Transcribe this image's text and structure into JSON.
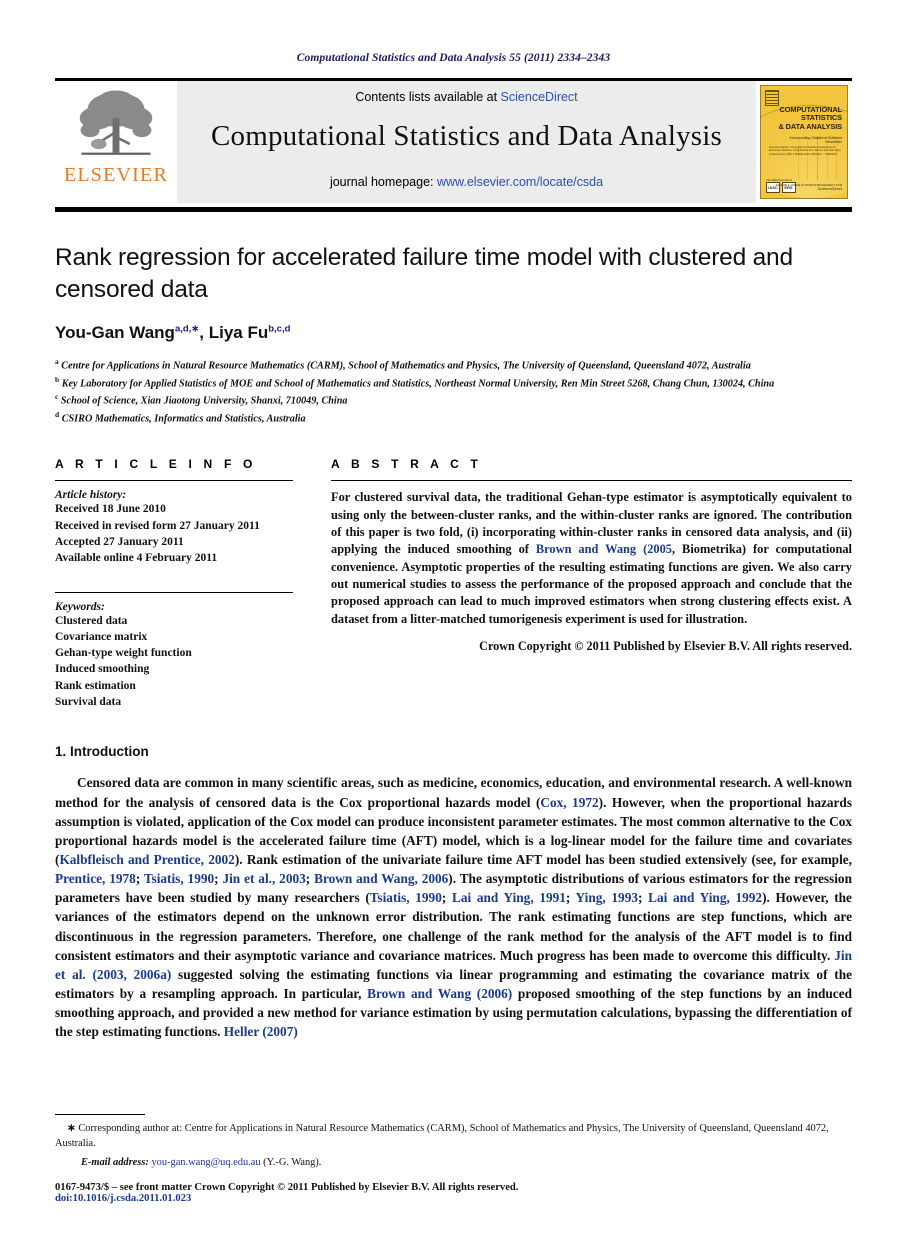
{
  "running_head": "Computational Statistics and Data Analysis 55 (2011) 2334–2343",
  "masthead": {
    "publisher_name": "ELSEVIER",
    "contents_prefix": "Contents lists available at ",
    "contents_link": "ScienceDirect",
    "journal_name": "Computational Statistics and Data Analysis",
    "homepage_prefix": "journal homepage: ",
    "homepage_link": "www.elsevier.com/locate/csda",
    "cover": {
      "title_line1": "COMPUTATIONAL",
      "title_line2": "STATISTICS",
      "title_line3": "& DATA ANALYSIS",
      "subtitle": "Incorporating  Statistical Software Newsletter",
      "editors_label": "Special Issue",
      "editors": "Honorary Editors: Computational Statistics Developments; Economic Statistics; Contributions from Recent and Alternative Achievements; ABS-1 MODELLING HISTORY – PRESENT",
      "issn_note": "The official journal of",
      "badges": [
        "IASC",
        "ERS"
      ],
      "sd_top": "AVAILABLE ONLINE AT WWW.SCIENCEDIRECT.COM",
      "sd_word": "ScienceDirect"
    }
  },
  "article": {
    "title": "Rank regression for accelerated failure time model with clustered and censored data",
    "authors": [
      {
        "name": "You-Gan Wang",
        "marks": "a,d,∗"
      },
      {
        "name": "Liya Fu",
        "marks": "b,c,d"
      }
    ],
    "author_separator": ", ",
    "affiliations": [
      {
        "mark": "a",
        "text": "Centre for Applications in Natural Resource Mathematics (CARM), School of Mathematics and Physics, The University of Queensland, Queensland 4072, Australia"
      },
      {
        "mark": "b",
        "text": "Key Laboratory for Applied Statistics of MOE and School of Mathematics and Statistics, Northeast Normal University, Ren Min Street 5268, Chang Chun, 130024, China"
      },
      {
        "mark": "c",
        "text": "School of Science, Xian Jiaotong University, Shanxi, 710049, China"
      },
      {
        "mark": "d",
        "text": "CSIRO Mathematics, Informatics and Statistics, Australia"
      }
    ]
  },
  "article_info": {
    "heading": "A R T I C L E    I N F O",
    "history_label": "Article history:",
    "history": [
      "Received 18 June 2010",
      "Received in revised form 27 January 2011",
      "Accepted 27 January 2011",
      "Available online 4 February 2011"
    ],
    "keywords_label": "Keywords:",
    "keywords": [
      "Clustered data",
      "Covariance matrix",
      "Gehan-type weight function",
      "Induced smoothing",
      "Rank estimation",
      "Survival data"
    ]
  },
  "abstract": {
    "heading": "A B S T R A C T",
    "part1": "For clustered survival data, the traditional Gehan-type estimator is asymptotically equivalent to using only the between-cluster ranks, and the within-cluster ranks are ignored. The contribution of this paper is two fold, (i) incorporating within-cluster ranks in censored data analysis, and (ii) applying the induced smoothing of ",
    "cite1": "Brown and Wang (2005",
    "part2": ", Biometrika) for computational convenience. Asymptotic properties of the resulting estimating functions are given. We also carry out numerical studies to assess the performance of the proposed approach and conclude that the proposed approach can lead to much improved estimators when strong clustering effects exist. A dataset from a litter-matched tumorigenesis experiment is used for illustration.",
    "copyright": "Crown Copyright © 2011 Published by Elsevier B.V. All rights reserved."
  },
  "introduction": {
    "heading": "1.  Introduction",
    "p1_a": "Censored data are common in many scientific areas, such as medicine, economics, education, and environmental research. A well-known method for the analysis of censored data is the Cox proportional hazards model (",
    "p1_cite1": "Cox, 1972",
    "p1_b": "). However, when the proportional hazards assumption is violated, application of the Cox model can produce inconsistent parameter estimates. The most common alternative to the Cox proportional hazards model is the accelerated failure time (AFT) model, which is a log-linear model for the failure time and covariates (",
    "p1_cite2": "Kalbfleisch and Prentice, 2002",
    "p1_c": "). Rank estimation of the univariate failure time AFT model has been studied extensively (see, for example, ",
    "p1_cite3": "Prentice, 1978",
    "p1_d": "; ",
    "p1_cite4": "Tsiatis, 1990",
    "p1_e": "; ",
    "p1_cite5": "Jin et al., 2003",
    "p1_f": "; ",
    "p1_cite6": "Brown and Wang, 2006",
    "p1_g": "). The asymptotic distributions of various estimators for the regression parameters have been studied by many researchers (",
    "p1_cite7": "Tsiatis, 1990",
    "p1_h": "; ",
    "p1_cite8": "Lai and Ying, 1991",
    "p1_i": "; ",
    "p1_cite9": "Ying, 1993",
    "p1_j": "; ",
    "p1_cite10": "Lai and Ying, 1992",
    "p1_k": "). However, the variances of the estimators depend on the unknown error distribution. The rank estimating functions are step functions, which are discontinuous in the regression parameters. Therefore, one challenge of the rank method for the analysis of the AFT model is to find consistent estimators and their asymptotic variance and covariance matrices. Much progress has been made to overcome this difficulty. ",
    "p1_cite11": "Jin et al. (2003, 2006a)",
    "p1_l": " suggested solving the estimating functions via linear programming and estimating the covariance matrix of the estimators by a resampling approach. In particular, ",
    "p1_cite12": "Brown and Wang (2006)",
    "p1_m": " proposed smoothing of the step functions by an induced smoothing approach, and provided a new method for variance estimation by using permutation calculations, bypassing the differentiation of the step estimating functions. ",
    "p1_cite13": "Heller (2007)"
  },
  "footnotes": {
    "corresponding_mark": "∗",
    "corresponding": " Corresponding author at: Centre for Applications in Natural Resource Mathematics (CARM), School of Mathematics and Physics, The University of Queensland, Queensland 4072, Australia.",
    "email_label": "E-mail address:",
    "email": "you-gan.wang@uq.edu.au",
    "email_suffix": " (Y.-G. Wang).",
    "issn_line": "0167-9473/$ – see front matter Crown Copyright © 2011 Published by Elsevier B.V. All rights reserved.",
    "doi": "doi:10.1016/j.csda.2011.01.023"
  },
  "colors": {
    "link_blue": "#2b50a8",
    "citation_blue": "#1a3a8f",
    "running_head_blue": "#1a1a60",
    "elsevier_orange": "#E87722",
    "cover_yellow": "#f2c53d"
  }
}
